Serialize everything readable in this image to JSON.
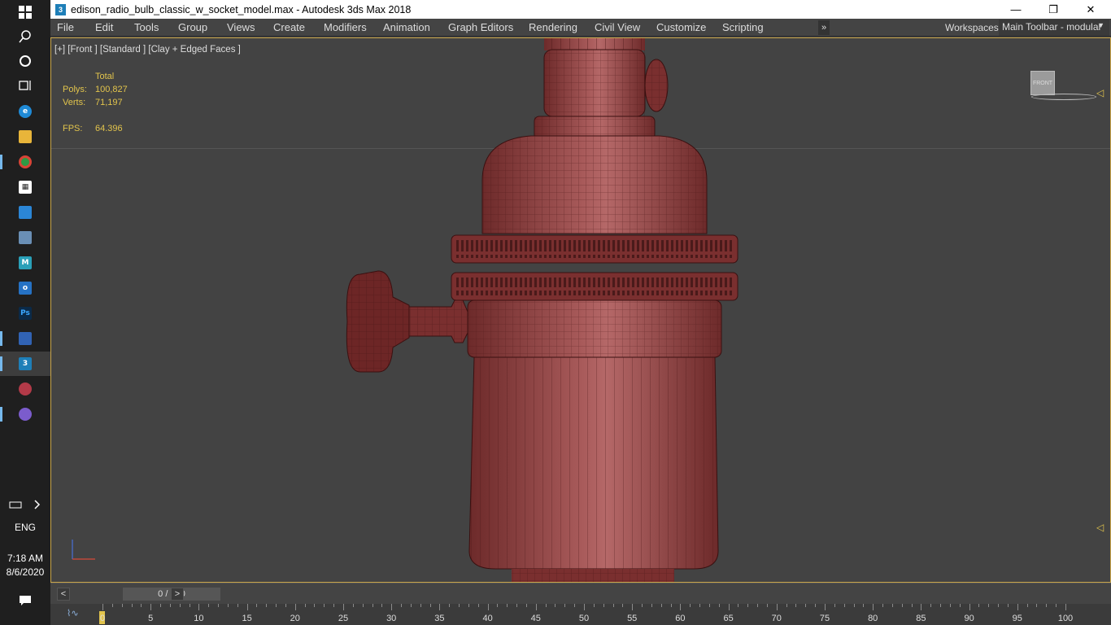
{
  "window": {
    "title": "edison_radio_bulb_classic_w_socket_model.max - Autodesk 3ds Max 2018",
    "app_icon": "3",
    "controls": {
      "minimize": "—",
      "restore": "❐",
      "close": "✕"
    }
  },
  "menu": {
    "items": [
      "File",
      "Edit",
      "Tools",
      "Group",
      "Views",
      "Create",
      "Modifiers",
      "Animation",
      "Graph Editors",
      "Rendering",
      "Civil View",
      "Customize",
      "Scripting"
    ],
    "more": "»",
    "workspaces_label": "Workspaces:",
    "workspace_value": "Main Toolbar - modular"
  },
  "viewport": {
    "label": "[+] [Front ] [Standard ] [Clay + Edged Faces ]",
    "stats": {
      "header": "Total",
      "polys_label": "Polys:",
      "polys": "100,827",
      "verts_label": "Verts:",
      "verts": "71,197",
      "fps_label": "FPS:",
      "fps": "64.396"
    },
    "viewcube_label": "FRONT"
  },
  "time_slider": {
    "prev": "<",
    "next": ">",
    "value": "0 / 100"
  },
  "track_bar": {
    "ticks": [
      "0",
      "5",
      "10",
      "15",
      "20",
      "25",
      "30",
      "35",
      "40",
      "45",
      "50",
      "55",
      "60",
      "65",
      "70",
      "75",
      "80",
      "85",
      "90",
      "95",
      "100"
    ]
  },
  "taskbar": {
    "icons": [
      "windows-start-icon",
      "search-icon",
      "cortana-icon",
      "task-view-icon",
      "edge-icon",
      "file-explorer-icon",
      "chrome-icon",
      "store-icon",
      "remote-desktop-icon",
      "photos-icon",
      "maya-icon",
      "outlook-icon",
      "photoshop-icon",
      "save-app-icon",
      "3dsmax-icon",
      "media-app-icon",
      "viber-icon"
    ],
    "language": "ENG",
    "time": "7:18 AM",
    "date": "8/6/2020"
  },
  "colors": {
    "model": "#8f3a3a",
    "model_highlight": "#a85a5a",
    "accent": "#e2c44c",
    "viewport_bg": "#434343"
  }
}
